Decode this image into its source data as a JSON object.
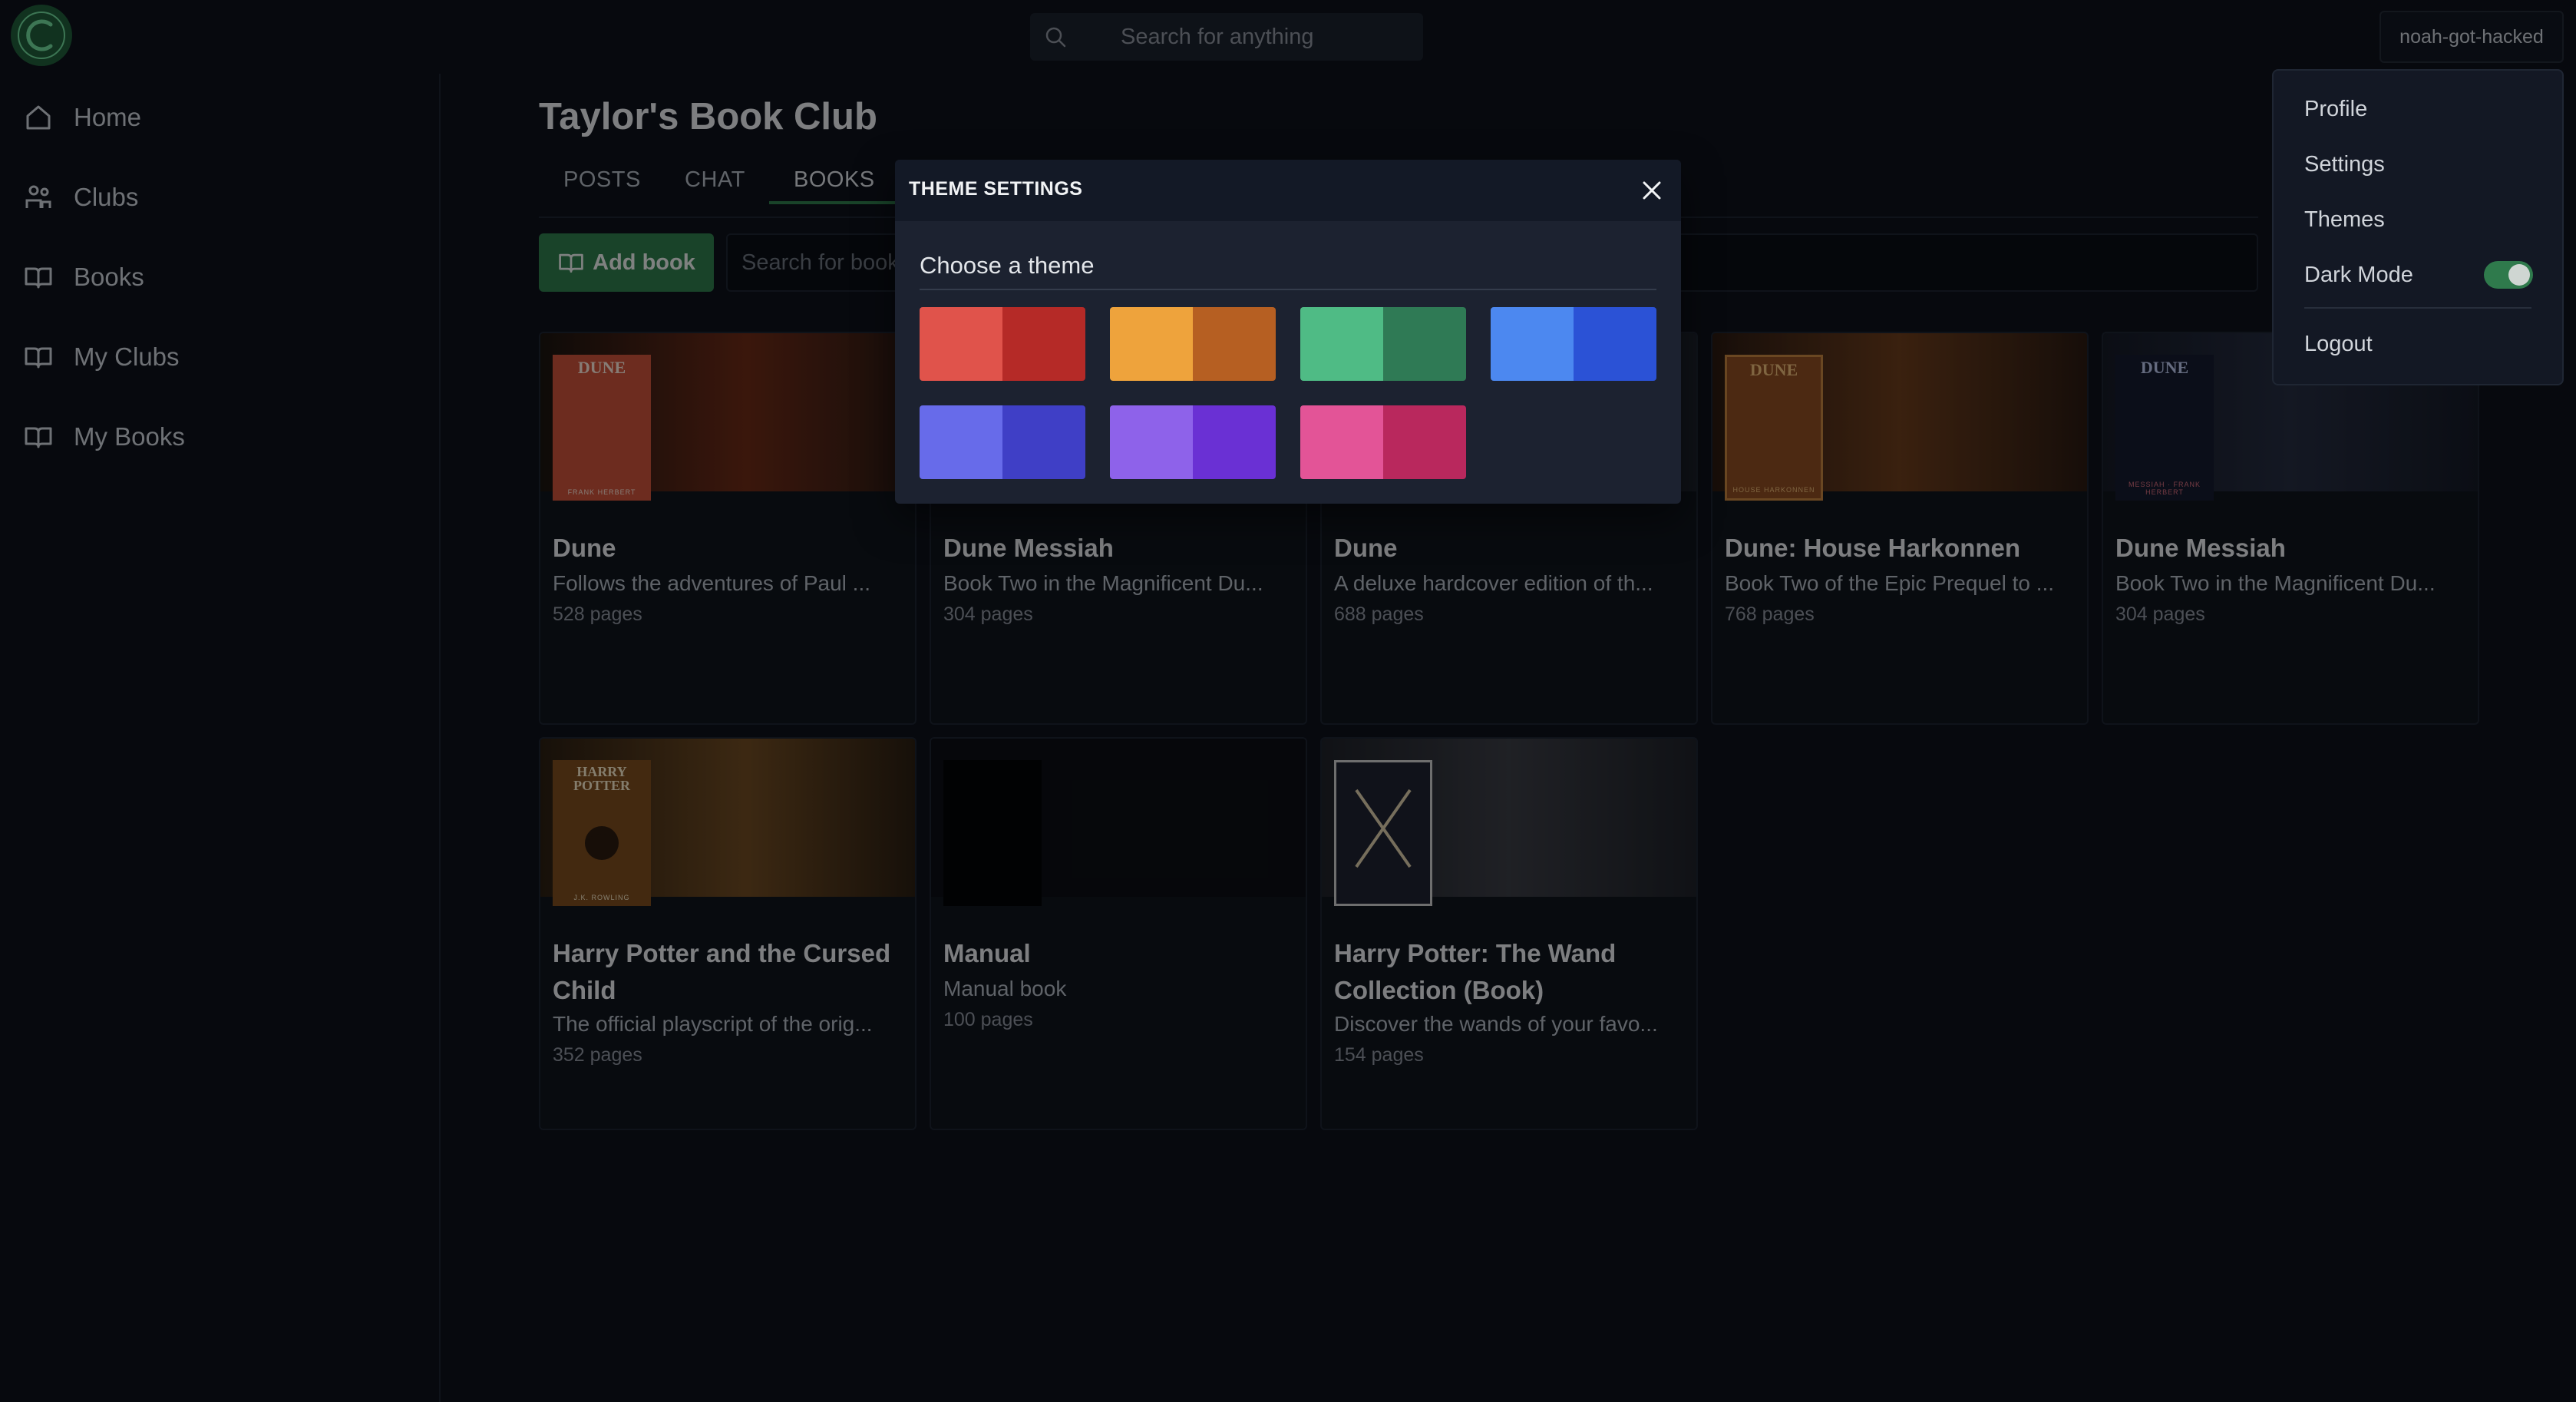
{
  "topbar": {
    "logo_letter": "C",
    "search_placeholder": "Search for anything",
    "username": "noah-got-hacked"
  },
  "sidebar": {
    "items": [
      {
        "label": "Home",
        "icon": "home-icon"
      },
      {
        "label": "Clubs",
        "icon": "clubs-icon"
      },
      {
        "label": "Books",
        "icon": "book-icon"
      },
      {
        "label": "My Clubs",
        "icon": "book-icon"
      },
      {
        "label": "My Books",
        "icon": "book-icon"
      }
    ]
  },
  "main": {
    "title": "Taylor's Book Club",
    "tabs": [
      {
        "label": "POSTS"
      },
      {
        "label": "CHAT"
      },
      {
        "label": "BOOKS",
        "active": true
      }
    ],
    "add_book_label": "Add book",
    "search_books_placeholder": "Search for books"
  },
  "books": [
    {
      "title": "Dune",
      "desc": "Follows the adventures of Paul ...",
      "pages": "528 pages",
      "cover_title": "DUNE",
      "cover_author": "FRANK HERBERT",
      "cover_color": "#c6503a",
      "banner_color": "#6b2a17"
    },
    {
      "title": "Dune Messiah",
      "desc": "Book Two in the Magnificent Du...",
      "pages": "304 pages",
      "cover_title": "",
      "cover_author": "",
      "cover_color": "#2a2f3c",
      "banner_color": "#2a2f3c"
    },
    {
      "title": "Dune",
      "desc": "A deluxe hardcover edition of th...",
      "pages": "688 pages",
      "cover_title": "",
      "cover_author": "",
      "cover_color": "#2a2f3c",
      "banner_color": "#2a2f3c"
    },
    {
      "title": "Dune: House Harkonnen",
      "desc": "Book Two of the Epic Prequel to ...",
      "pages": "768 pages",
      "cover_title": "DUNE",
      "cover_author": "HOUSE HARKONNEN",
      "cover_color": "#8a4b22",
      "banner_color": "#5d3418"
    },
    {
      "title": "Dune Messiah",
      "desc": "Book Two in the Magnificent Du...",
      "pages": "304 pages",
      "cover_title": "DUNE",
      "cover_author": "MESSIAH · FRANK HERBERT",
      "cover_color": "#151b2e",
      "banner_color": "#1f2638"
    },
    {
      "title": "Harry Potter and the Cursed Child",
      "desc": "The official playscript of the orig...",
      "pages": "352 pages",
      "cover_title": "HARRY POTTER",
      "cover_author": "J.K. ROWLING",
      "cover_color": "#7a4c1e",
      "banner_color": "#5a3a18"
    },
    {
      "title": "Manual",
      "desc": "Manual book",
      "pages": "100 pages",
      "cover_title": "",
      "cover_author": "",
      "cover_color": "#030407",
      "banner_color": "#0b0e14"
    },
    {
      "title": "Harry Potter: The Wand Collection (Book)",
      "desc": "Discover the wands of your favo...",
      "pages": "154 pages",
      "cover_title": "",
      "cover_author": "",
      "cover_color": "#1e2230",
      "banner_color": "#262b36"
    }
  ],
  "account_menu": {
    "items": [
      "Profile",
      "Settings",
      "Themes",
      "Dark Mode",
      "Logout"
    ],
    "dark_mode_on": true
  },
  "theme_modal": {
    "title": "THEME SETTINGS",
    "subtitle": "Choose a theme",
    "themes": [
      {
        "name": "red",
        "light": "#e0534b",
        "dark": "#b52a27"
      },
      {
        "name": "orange",
        "light": "#eea33c",
        "dark": "#b65f22"
      },
      {
        "name": "green",
        "light": "#4fbb85",
        "dark": "#2f7a55"
      },
      {
        "name": "blue",
        "light": "#4c88f0",
        "dark": "#2b52d6"
      },
      {
        "name": "indigo",
        "light": "#676bea",
        "dark": "#3f3fc6"
      },
      {
        "name": "purple",
        "light": "#8e62ea",
        "dark": "#6a30d4"
      },
      {
        "name": "pink",
        "light": "#e35497",
        "dark": "#b9285d"
      }
    ]
  },
  "colors": {
    "accent": "#2f7a4c",
    "background": "#0d111a"
  }
}
